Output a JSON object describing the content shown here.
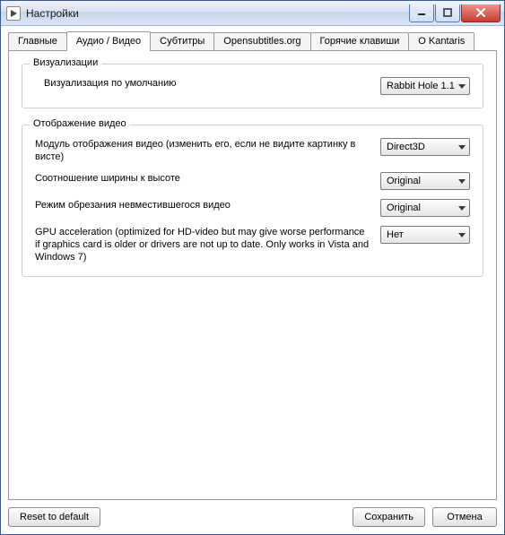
{
  "window": {
    "title": "Настройки"
  },
  "tabs": {
    "main": "Главные",
    "av": "Аудио / Видео",
    "subs": "Субтитры",
    "osub": "Opensubtitles.org",
    "hotkeys": "Горячие клавиши",
    "about": "О Kantaris"
  },
  "groups": {
    "visualizations": {
      "title": "Визуализации",
      "default_vis_label": "Визуализация по умолчанию",
      "default_vis_value": "Rabbit Hole 1.1"
    },
    "video": {
      "title": "Отображение видео",
      "output_label": "Модуль отображения видео (изменить его, если не видите картинку в висте)",
      "output_value": "Direct3D",
      "aspect_label": "Соотношение ширины к высоте",
      "aspect_value": "Original",
      "crop_label": "Режим обрезания невместившегося видео",
      "crop_value": "Original",
      "gpu_label": "GPU acceleration (optimized for HD-video but may give worse performance if graphics card is older or drivers are not up to date.  Only works in Vista and Windows 7)",
      "gpu_value": "Нет"
    }
  },
  "buttons": {
    "reset": "Reset to default",
    "save": "Сохранить",
    "cancel": "Отмена"
  }
}
